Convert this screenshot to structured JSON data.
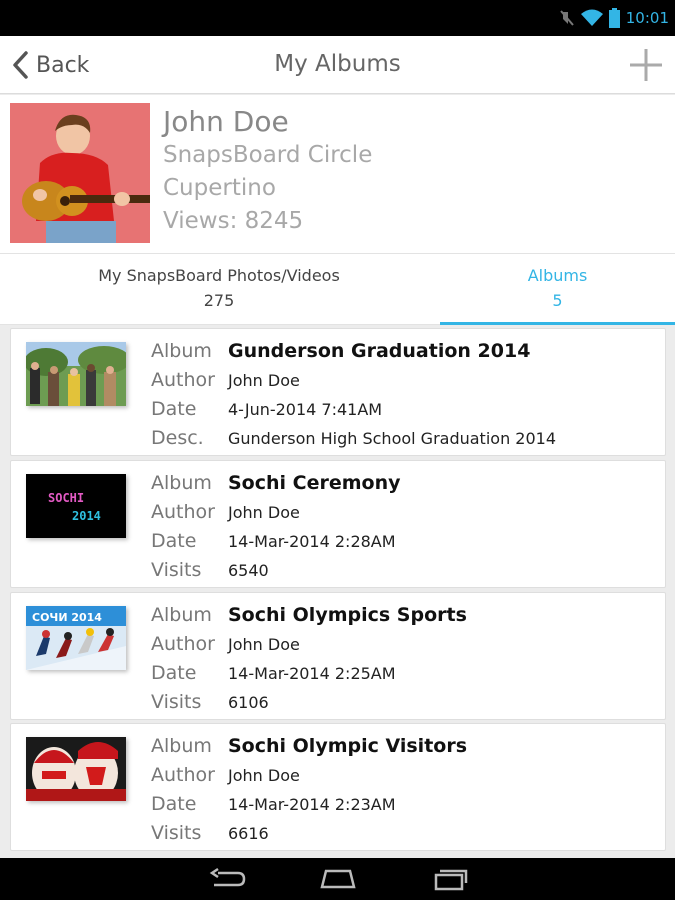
{
  "status_bar": {
    "time": "10:01"
  },
  "header": {
    "back_label": "Back",
    "title": "My Albums"
  },
  "profile": {
    "name": "John Doe",
    "circle": "SnapsBoard Circle",
    "location": "Cupertino",
    "views": "Views: 8245"
  },
  "tabs": [
    {
      "label": "My SnapsBoard Photos/Videos",
      "count": "275"
    },
    {
      "label": "Albums",
      "count": "5"
    }
  ],
  "albums": [
    {
      "k1": "Album",
      "title": "Gunderson Graduation 2014",
      "k2": "Author",
      "author": "John Doe",
      "k3": "Date",
      "date": "4-Jun-2014 7:41AM",
      "k4": "Desc.",
      "extra": "Gunderson High School Graduation 2014"
    },
    {
      "k1": "Album",
      "title": "Sochi Ceremony",
      "k2": "Author",
      "author": "John Doe",
      "k3": "Date",
      "date": "14-Mar-2014 2:28AM",
      "k4": "Visits",
      "extra": "6540"
    },
    {
      "k1": "Album",
      "title": "Sochi Olympics Sports",
      "k2": "Author",
      "author": "John Doe",
      "k3": "Date",
      "date": "14-Mar-2014 2:25AM",
      "k4": "Visits",
      "extra": "6106"
    },
    {
      "k1": "Album",
      "title": "Sochi Olympic Visitors",
      "k2": "Author",
      "author": "John Doe",
      "k3": "Date",
      "date": "14-Mar-2014 2:23AM",
      "k4": "Visits",
      "extra": "6616"
    }
  ],
  "thumb_texts": {
    "sochi_logo_line1": "SOCHI",
    "sochi_logo_line2": "2014",
    "sports_banner": "СОЧИ 2014"
  },
  "colors": {
    "accent": "#33b5e5",
    "text_dark": "#222222",
    "text_muted": "#a8a8a8"
  },
  "icons": [
    "back-chevron-icon",
    "add-icon",
    "mute-icon",
    "wifi-icon",
    "battery-icon",
    "nav-back-icon",
    "nav-home-icon",
    "nav-recents-icon"
  ]
}
